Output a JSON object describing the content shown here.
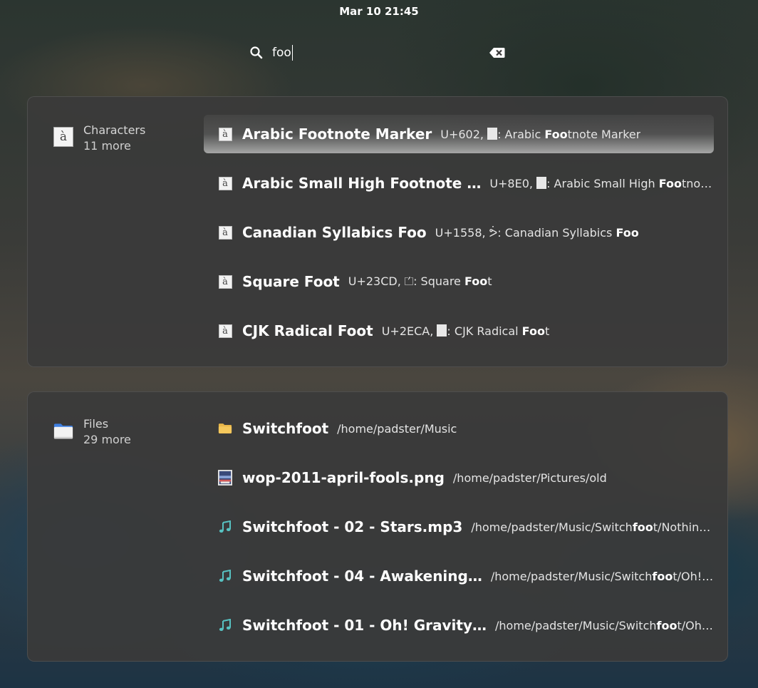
{
  "topbar": {
    "clock": "Mar 10  21:45"
  },
  "search": {
    "query": "foo"
  },
  "characters": {
    "provider_name": "Characters",
    "provider_more": "11 more",
    "results": [
      {
        "title": "Arabic Footnote Marker",
        "desc_pre": "U+602, ",
        "desc_mid": ": Arabic ",
        "desc_bold": "Foo",
        "desc_post": "tnote Marker"
      },
      {
        "title": "Arabic Small High Footnote …",
        "desc_pre": "U+8E0, ",
        "desc_mid": ": Arabic Small High ",
        "desc_bold": "Foo",
        "desc_post": "tnot…"
      },
      {
        "title": "Canadian Syllabics Foo",
        "desc_pre": "U+1558, ",
        "glyph": "ᕘ",
        "desc_mid": ": Canadian Syllabics ",
        "desc_bold": "Foo",
        "desc_post": ""
      },
      {
        "title": "Square Foot",
        "desc_pre": "U+23CD, ",
        "glyph": "⏍",
        "desc_mid": ": Square ",
        "desc_bold": "Foo",
        "desc_post": "t"
      },
      {
        "title": "CJK Radical Foot",
        "desc_pre": "U+2ECA, ",
        "desc_mid": ": CJK Radical ",
        "desc_bold": "Foo",
        "desc_post": "t"
      }
    ]
  },
  "files": {
    "provider_name": "Files",
    "provider_more": "29 more",
    "results": [
      {
        "icon": "folder-icon",
        "title": "Switchfoot",
        "path_pre": "/home/padster/Music",
        "path_bold": "",
        "path_post": ""
      },
      {
        "icon": "image-file-icon",
        "title": "wop-2011-april-fools.png",
        "path_pre": "/home/padster/Pictures/old",
        "path_bold": "",
        "path_post": ""
      },
      {
        "icon": "music-note-icon",
        "title": "Switchfoot - 02 - Stars.mp3",
        "path_pre": "/home/padster/Music/Switch",
        "path_bold": "foo",
        "path_post": "t/Nothing …"
      },
      {
        "icon": "music-note-icon",
        "title": "Switchfoot - 04 - Awakening…",
        "path_pre": "/home/padster/Music/Switch",
        "path_bold": "foo",
        "path_post": "t/Oh! …"
      },
      {
        "icon": "music-note-icon",
        "title": "Switchfoot - 01 - Oh! Gravity…",
        "path_pre": "/home/padster/Music/Switch",
        "path_bold": "foo",
        "path_post": "t/Oh! …"
      }
    ]
  }
}
